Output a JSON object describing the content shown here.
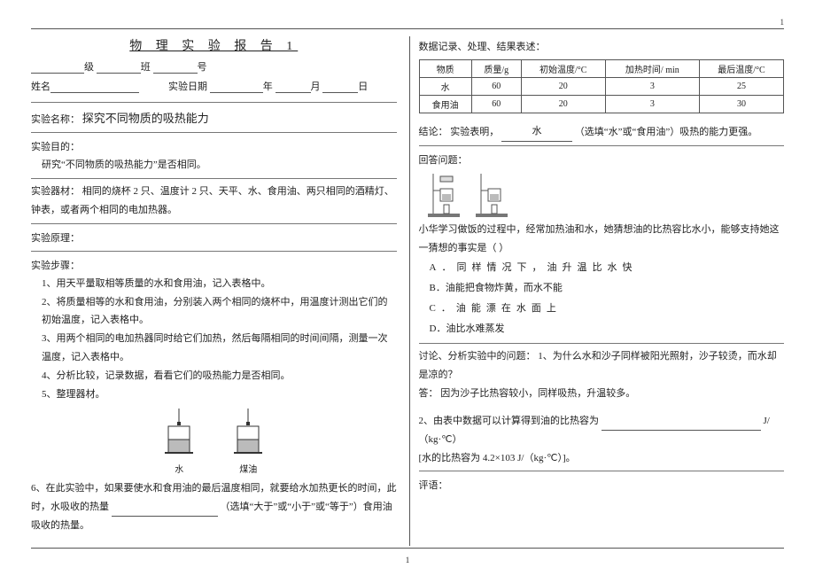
{
  "page_top": "1",
  "page_bottom": "1",
  "title": "物 理 实 验 报 告 1",
  "header": {
    "grade": "级",
    "class": "班",
    "number": "号",
    "name_label": "姓名",
    "date_label": "实验日期",
    "year": "年",
    "month": "月",
    "day": "日"
  },
  "left": {
    "name_label": "实验名称：",
    "name_value": "探究不同物质的吸热能力",
    "purpose_label": "实验目的：",
    "purpose_value": "研究“不同物质的吸热能力”是否相同。",
    "equip_label": "实验器材：",
    "equip_value": "相同的烧杯 2 只、温度计 2 只、天平、水、食用油、两只相同的酒精灯、钟表，或者两个相同的电加热器。",
    "principle_label": "实验原理：",
    "steps_label": "实验步骤：",
    "steps": [
      "1、用天平量取相等质量的水和食用油，记入表格中。",
      "2、将质量相等的水和食用油，分别装入两个相同的烧杯中，用温度计测出它们的初始温度，记入表格中。",
      "3、用两个相同的电加热器同时给它们加热，然后每隔相同的时间间隔，测量一次温度，记入表格中。",
      "4、分析比较，记录数据，看看它们的吸热能力是否相同。",
      "5、整理器材。"
    ],
    "beaker_left": "水",
    "beaker_right": "煤油",
    "q6": "6、在此实验中，如果要使水和食用油的最后温度相同，就要给水加热更长的时间，此时，水吸收的热量",
    "q6_hint": "（选填“大于”或“小于”或“等于”）食用油吸收的热量。"
  },
  "right": {
    "records_label": "数据记录、处理、结果表述：",
    "tbl_h1": "物质",
    "tbl_h2": "质量/g",
    "tbl_h3": "初始温度/°C",
    "tbl_h4": "加热时间/ min",
    "tbl_h5": "最后温度/°C",
    "row1": {
      "c1": "水",
      "c2": "60",
      "c3": "20",
      "c4": "3",
      "c5": "25"
    },
    "row2": {
      "c1": "食用油",
      "c2": "60",
      "c3": "20",
      "c4": "3",
      "c5": "30"
    },
    "conclusion_label": "结论：",
    "conclusion_pre": "实验表明，",
    "conclusion_ans": "水",
    "conclusion_post": "（选填“水”或“食用油”）吸热的能力更强。",
    "qa_label": "回答问题：",
    "qa_intro": "小华学习做饭的过程中，经常加热油和水，她猜想油的比热容比水小，能够支持她这一猜想的事实是（    ）",
    "optA": "A．同样情况下，油升温比水快",
    "optB": "B．油能把食物炸黄，而水不能",
    "optC": "C．油能漂在水面上",
    "optD": "D．油比水难蒸发",
    "discuss_label": "讨论、分析实验中的问题：",
    "discuss_q": "1、为什么水和沙子同样被阳光照射，沙子较烫，而水却是凉的？",
    "discuss_a_label": "答：",
    "discuss_a": "因为沙子比热容较小，同样吸热，升温较多。",
    "q2": "2、由表中数据可以计算得到油的比热容为",
    "q2_unit": "J/（kg·℃）",
    "q2_hint": "[水的比热容为 4.2×103 J/（kg·℃）]。",
    "comment_label": "评语："
  }
}
